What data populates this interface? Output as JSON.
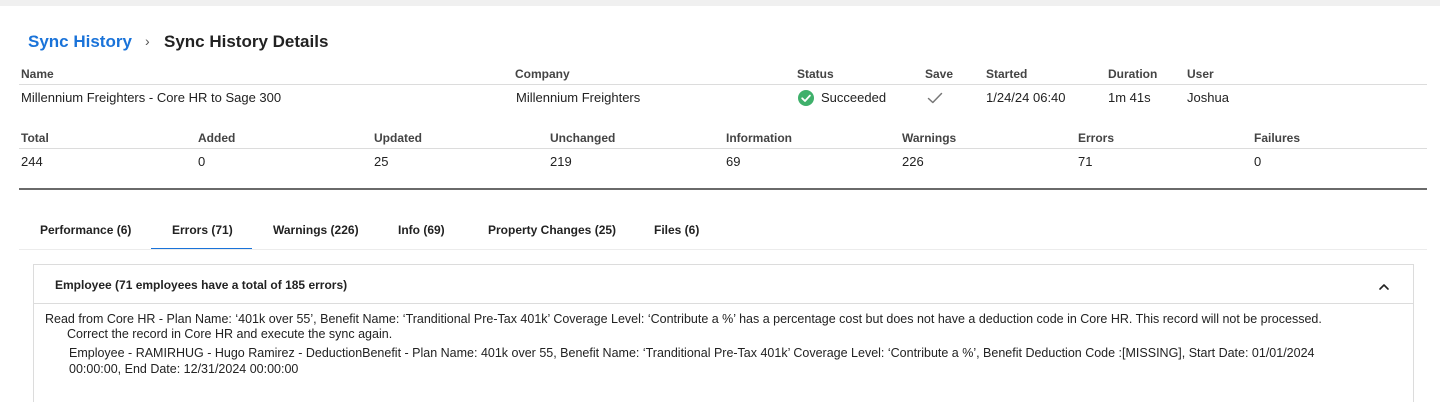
{
  "breadcrumb": {
    "parent": "Sync History",
    "separator": "›",
    "current": "Sync History Details"
  },
  "summary": {
    "headers": {
      "name": "Name",
      "company": "Company",
      "status": "Status",
      "save": "Save",
      "started": "Started",
      "duration": "Duration",
      "user": "User"
    },
    "values": {
      "name": "Millennium Freighters - Core HR to Sage 300",
      "company": "Millennium Freighters",
      "status": "Succeeded",
      "started": "1/24/24 06:40",
      "duration": "1m 41s",
      "user": "Joshua"
    }
  },
  "counts": {
    "headers": [
      "Total",
      "Added",
      "Updated",
      "Unchanged",
      "Information",
      "Warnings",
      "Errors",
      "Failures"
    ],
    "values": [
      "244",
      "0",
      "25",
      "219",
      "69",
      "226",
      "71",
      "0"
    ]
  },
  "tabs": [
    {
      "label": "Performance (6)",
      "active": false
    },
    {
      "label": "Errors (71)",
      "active": true
    },
    {
      "label": "Warnings (226)",
      "active": false
    },
    {
      "label": "Info (69)",
      "active": false
    },
    {
      "label": "Property Changes (25)",
      "active": false
    },
    {
      "label": "Files (6)",
      "active": false
    }
  ],
  "error_group": {
    "title": "Employee (71 employees have a total of 185 errors)",
    "message_line1": "Read from Core HR - Plan Name: ‘401k over 55’, Benefit Name: ‘Tranditional Pre-Tax 401k’ Coverage Level: ‘Contribute a %’ has a percentage cost but does not have a deduction code in Core HR. This record will not be processed.",
    "message_line2": "Correct the record in Core HR and execute the sync again.",
    "detail_line1": "Employee - RAMIRHUG - Hugo Ramirez - DeductionBenefit - Plan Name: 401k over 55, Benefit Name: ‘Tranditional Pre-Tax 401k’ Coverage Level: ‘Contribute a %’, Benefit Deduction Code :[MISSING], Start Date: 01/01/2024",
    "detail_line2": "00:00:00, End Date: 12/31/2024 00:00:00"
  },
  "colors": {
    "accent": "#1a73d9",
    "success": "#3fb06b"
  },
  "icons": {
    "status": "check-circle-icon",
    "save": "checkmark-icon",
    "collapse": "chevron-up-icon"
  }
}
